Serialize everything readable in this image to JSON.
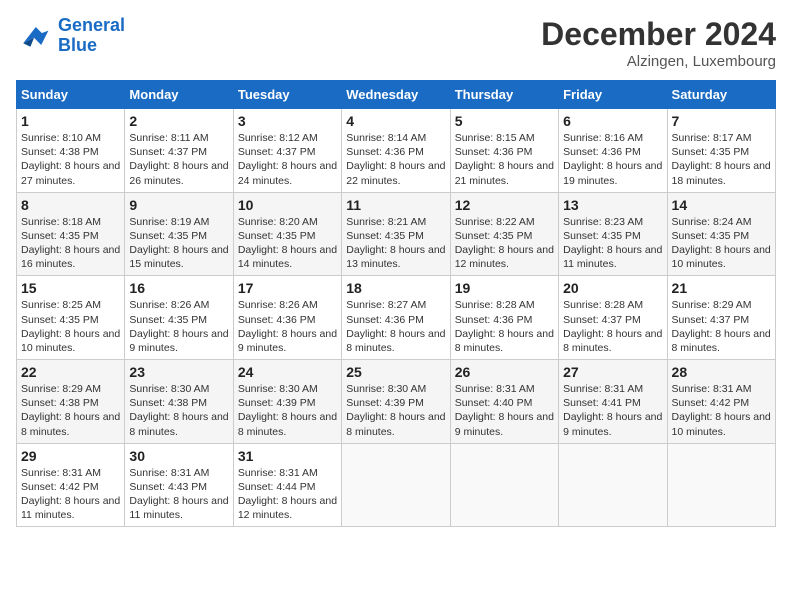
{
  "header": {
    "logo_line1": "General",
    "logo_line2": "Blue",
    "month_title": "December 2024",
    "subtitle": "Alzingen, Luxembourg"
  },
  "weekdays": [
    "Sunday",
    "Monday",
    "Tuesday",
    "Wednesday",
    "Thursday",
    "Friday",
    "Saturday"
  ],
  "weeks": [
    [
      {
        "day": "1",
        "sunrise": "8:10 AM",
        "sunset": "4:38 PM",
        "daylight": "8 hours and 27 minutes."
      },
      {
        "day": "2",
        "sunrise": "8:11 AM",
        "sunset": "4:37 PM",
        "daylight": "8 hours and 26 minutes."
      },
      {
        "day": "3",
        "sunrise": "8:12 AM",
        "sunset": "4:37 PM",
        "daylight": "8 hours and 24 minutes."
      },
      {
        "day": "4",
        "sunrise": "8:14 AM",
        "sunset": "4:36 PM",
        "daylight": "8 hours and 22 minutes."
      },
      {
        "day": "5",
        "sunrise": "8:15 AM",
        "sunset": "4:36 PM",
        "daylight": "8 hours and 21 minutes."
      },
      {
        "day": "6",
        "sunrise": "8:16 AM",
        "sunset": "4:36 PM",
        "daylight": "8 hours and 19 minutes."
      },
      {
        "day": "7",
        "sunrise": "8:17 AM",
        "sunset": "4:35 PM",
        "daylight": "8 hours and 18 minutes."
      }
    ],
    [
      {
        "day": "8",
        "sunrise": "8:18 AM",
        "sunset": "4:35 PM",
        "daylight": "8 hours and 16 minutes."
      },
      {
        "day": "9",
        "sunrise": "8:19 AM",
        "sunset": "4:35 PM",
        "daylight": "8 hours and 15 minutes."
      },
      {
        "day": "10",
        "sunrise": "8:20 AM",
        "sunset": "4:35 PM",
        "daylight": "8 hours and 14 minutes."
      },
      {
        "day": "11",
        "sunrise": "8:21 AM",
        "sunset": "4:35 PM",
        "daylight": "8 hours and 13 minutes."
      },
      {
        "day": "12",
        "sunrise": "8:22 AM",
        "sunset": "4:35 PM",
        "daylight": "8 hours and 12 minutes."
      },
      {
        "day": "13",
        "sunrise": "8:23 AM",
        "sunset": "4:35 PM",
        "daylight": "8 hours and 11 minutes."
      },
      {
        "day": "14",
        "sunrise": "8:24 AM",
        "sunset": "4:35 PM",
        "daylight": "8 hours and 10 minutes."
      }
    ],
    [
      {
        "day": "15",
        "sunrise": "8:25 AM",
        "sunset": "4:35 PM",
        "daylight": "8 hours and 10 minutes."
      },
      {
        "day": "16",
        "sunrise": "8:26 AM",
        "sunset": "4:35 PM",
        "daylight": "8 hours and 9 minutes."
      },
      {
        "day": "17",
        "sunrise": "8:26 AM",
        "sunset": "4:36 PM",
        "daylight": "8 hours and 9 minutes."
      },
      {
        "day": "18",
        "sunrise": "8:27 AM",
        "sunset": "4:36 PM",
        "daylight": "8 hours and 8 minutes."
      },
      {
        "day": "19",
        "sunrise": "8:28 AM",
        "sunset": "4:36 PM",
        "daylight": "8 hours and 8 minutes."
      },
      {
        "day": "20",
        "sunrise": "8:28 AM",
        "sunset": "4:37 PM",
        "daylight": "8 hours and 8 minutes."
      },
      {
        "day": "21",
        "sunrise": "8:29 AM",
        "sunset": "4:37 PM",
        "daylight": "8 hours and 8 minutes."
      }
    ],
    [
      {
        "day": "22",
        "sunrise": "8:29 AM",
        "sunset": "4:38 PM",
        "daylight": "8 hours and 8 minutes."
      },
      {
        "day": "23",
        "sunrise": "8:30 AM",
        "sunset": "4:38 PM",
        "daylight": "8 hours and 8 minutes."
      },
      {
        "day": "24",
        "sunrise": "8:30 AM",
        "sunset": "4:39 PM",
        "daylight": "8 hours and 8 minutes."
      },
      {
        "day": "25",
        "sunrise": "8:30 AM",
        "sunset": "4:39 PM",
        "daylight": "8 hours and 8 minutes."
      },
      {
        "day": "26",
        "sunrise": "8:31 AM",
        "sunset": "4:40 PM",
        "daylight": "8 hours and 9 minutes."
      },
      {
        "day": "27",
        "sunrise": "8:31 AM",
        "sunset": "4:41 PM",
        "daylight": "8 hours and 9 minutes."
      },
      {
        "day": "28",
        "sunrise": "8:31 AM",
        "sunset": "4:42 PM",
        "daylight": "8 hours and 10 minutes."
      }
    ],
    [
      {
        "day": "29",
        "sunrise": "8:31 AM",
        "sunset": "4:42 PM",
        "daylight": "8 hours and 11 minutes."
      },
      {
        "day": "30",
        "sunrise": "8:31 AM",
        "sunset": "4:43 PM",
        "daylight": "8 hours and 11 minutes."
      },
      {
        "day": "31",
        "sunrise": "8:31 AM",
        "sunset": "4:44 PM",
        "daylight": "8 hours and 12 minutes."
      },
      null,
      null,
      null,
      null
    ]
  ]
}
